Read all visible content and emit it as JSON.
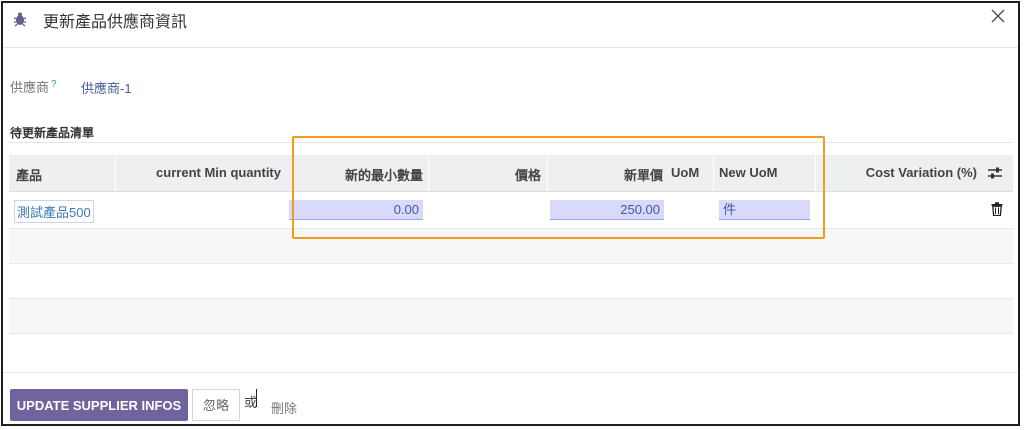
{
  "dialog": {
    "title": "更新產品供應商資訊"
  },
  "form": {
    "supplier_label": "供應商",
    "supplier_help": "?",
    "supplier_value": "供應商-1",
    "section_title": "待更新產品清單"
  },
  "table": {
    "columns": [
      "產品",
      "current Min quantity",
      "新的最小數量",
      "價格",
      "新單價",
      "UoM",
      "New UoM",
      "Cost Variation (%)"
    ],
    "rows": [
      {
        "product": "測試產品500",
        "current_min_quantity": "",
        "new_min_quantity": "0.00",
        "price": "",
        "new_unit_price": "250.00",
        "uom": "",
        "new_uom": "件",
        "cost_variation": ""
      }
    ]
  },
  "footer": {
    "update_button": "UPDATE SUPPLIER INFOS",
    "ignore_button": "忽略",
    "or_text": "或",
    "delete_link": "刪除"
  },
  "colors": {
    "primary": "#71639e",
    "highlight": "#f29b1d",
    "input_bg": "#d9d9fb",
    "link": "#3a7ab0"
  }
}
